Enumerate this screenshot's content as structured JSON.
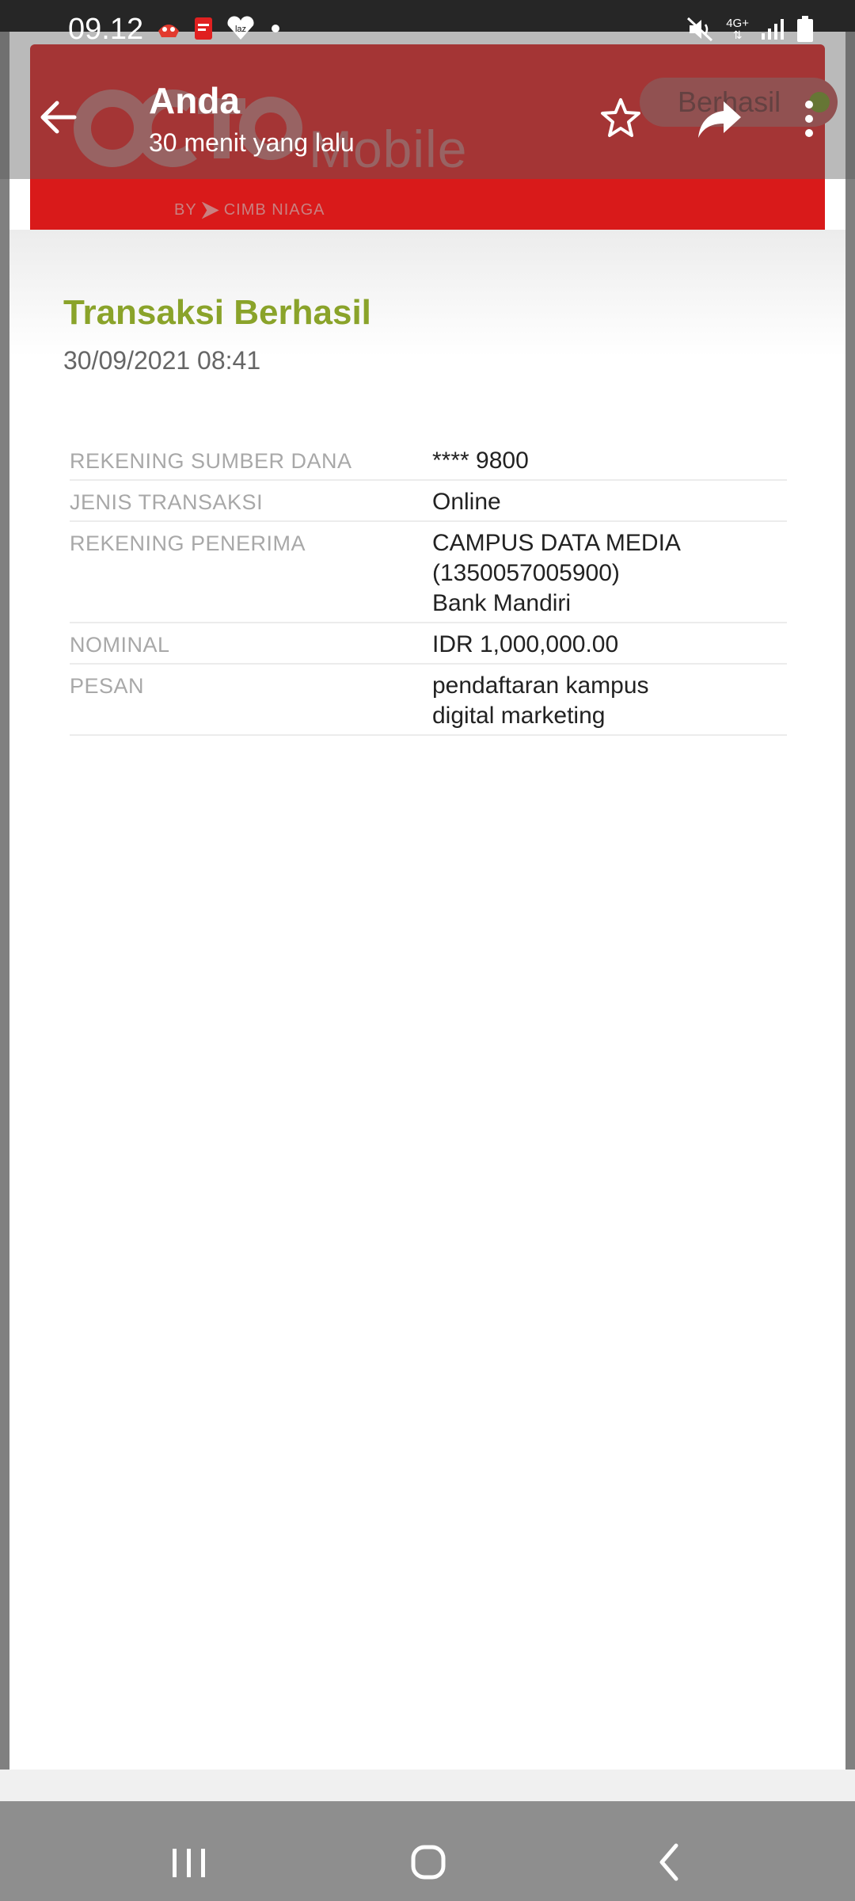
{
  "status_bar": {
    "time": "09.12",
    "network": "4G+"
  },
  "viewer": {
    "sender": "Anda",
    "sent_ago": "30 menit yang lalu"
  },
  "brand": {
    "logo_text": "OCTO Mobile",
    "mobile_word": "Mobile",
    "by_text": "BY",
    "bank_text": "CIMB NIAGA",
    "status_label": "Berhasil"
  },
  "receipt": {
    "title": "Transaksi Berhasil",
    "datetime": "30/09/2021 08:41",
    "rows": [
      {
        "label": "REKENING SUMBER DANA",
        "lines": [
          "**** 9800"
        ]
      },
      {
        "label": "JENIS TRANSAKSI",
        "lines": [
          "Online"
        ]
      },
      {
        "label": "REKENING PENERIMA",
        "lines": [
          "CAMPUS DATA MEDIA",
          "(1350057005900)",
          "Bank Mandiri"
        ]
      },
      {
        "label": "NOMINAL",
        "lines": [
          "IDR 1,000,000.00"
        ]
      },
      {
        "label": "PESAN",
        "lines": [
          "pendaftaran kampus",
          "digital marketing"
        ]
      }
    ]
  },
  "colors": {
    "brand_red": "#d91a1a",
    "title_green": "#8aa32a",
    "status_dot": "#6f8a1a"
  }
}
